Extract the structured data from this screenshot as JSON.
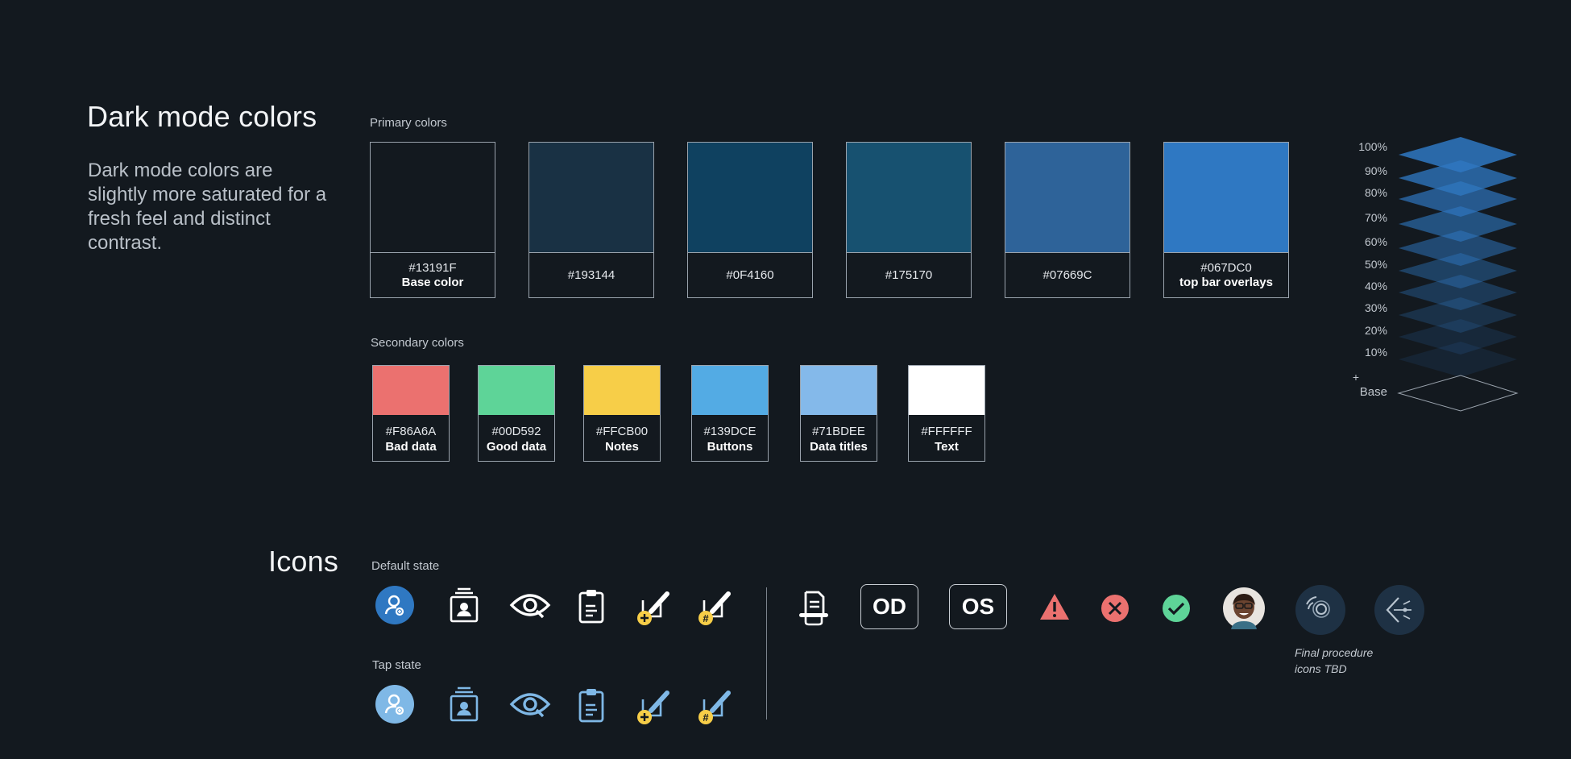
{
  "colors_section": {
    "title": "Dark mode colors",
    "description": "Dark mode colors are slightly more saturated for a fresh feel and distinct contrast.",
    "primary_label": "Primary colors",
    "secondary_label": "Secondary colors",
    "primary": [
      {
        "hex": "#13191F",
        "name": "Base color",
        "color": "#13191F"
      },
      {
        "hex": "#193144",
        "name": "",
        "color": "#193144"
      },
      {
        "hex": "#0F4160",
        "name": "",
        "color": "#0F4160"
      },
      {
        "hex": "#175170",
        "name": "",
        "color": "#175170"
      },
      {
        "hex": "#07669C",
        "name": "",
        "color": "#2E6399"
      },
      {
        "hex": "#067DC0",
        "name": "top bar overlays",
        "color": "#2F78C2"
      }
    ],
    "secondary": [
      {
        "hex": "#F86A6A",
        "name": "Bad data",
        "color": "#EB716F"
      },
      {
        "hex": "#00D592",
        "name": "Good data",
        "color": "#5ED498"
      },
      {
        "hex": "#FFCB00",
        "name": "Notes",
        "color": "#F7CE48"
      },
      {
        "hex": "#139DCE",
        "name": "Buttons",
        "color": "#53ABE4"
      },
      {
        "hex": "#71BDEE",
        "name": "Data titles",
        "color": "#84B9EA"
      },
      {
        "hex": "#FFFFFF",
        "name": "Text",
        "color": "#FFFFFF"
      }
    ]
  },
  "opacity_legend": {
    "levels": [
      {
        "label": "100%",
        "opacity": 1.0
      },
      {
        "label": "90%",
        "opacity": 0.9
      },
      {
        "label": "80%",
        "opacity": 0.8
      },
      {
        "label": "70%",
        "opacity": 0.7
      },
      {
        "label": "60%",
        "opacity": 0.6
      },
      {
        "label": "50%",
        "opacity": 0.5
      },
      {
        "label": "40%",
        "opacity": 0.4
      },
      {
        "label": "30%",
        "opacity": 0.3
      },
      {
        "label": "20%",
        "opacity": 0.2
      },
      {
        "label": "10%",
        "opacity": 0.1
      }
    ],
    "plus_label": "+",
    "base_label": "Base",
    "layer_color": "#2F78C2"
  },
  "icons_section": {
    "title": "Icons",
    "default_label": "Default state",
    "tap_label": "Tap state",
    "default_icons": [
      "add-user-icon",
      "patient-card-icon",
      "eye-icon",
      "clipboard-icon",
      "edit-plus-icon",
      "edit-hash-icon"
    ],
    "tap_icons": [
      "add-user-icon",
      "patient-card-icon",
      "eye-icon",
      "clipboard-icon",
      "edit-plus-icon",
      "edit-hash-icon"
    ],
    "od_label": "OD",
    "os_label": "OS",
    "note_line1": "Final procedure",
    "note_line2": "icons TBD",
    "accent_blue": "#2F78C2",
    "tap_blue": "#7FB8E6",
    "yellow": "#F7CE48",
    "red": "#EB716F",
    "green": "#5ED498"
  }
}
